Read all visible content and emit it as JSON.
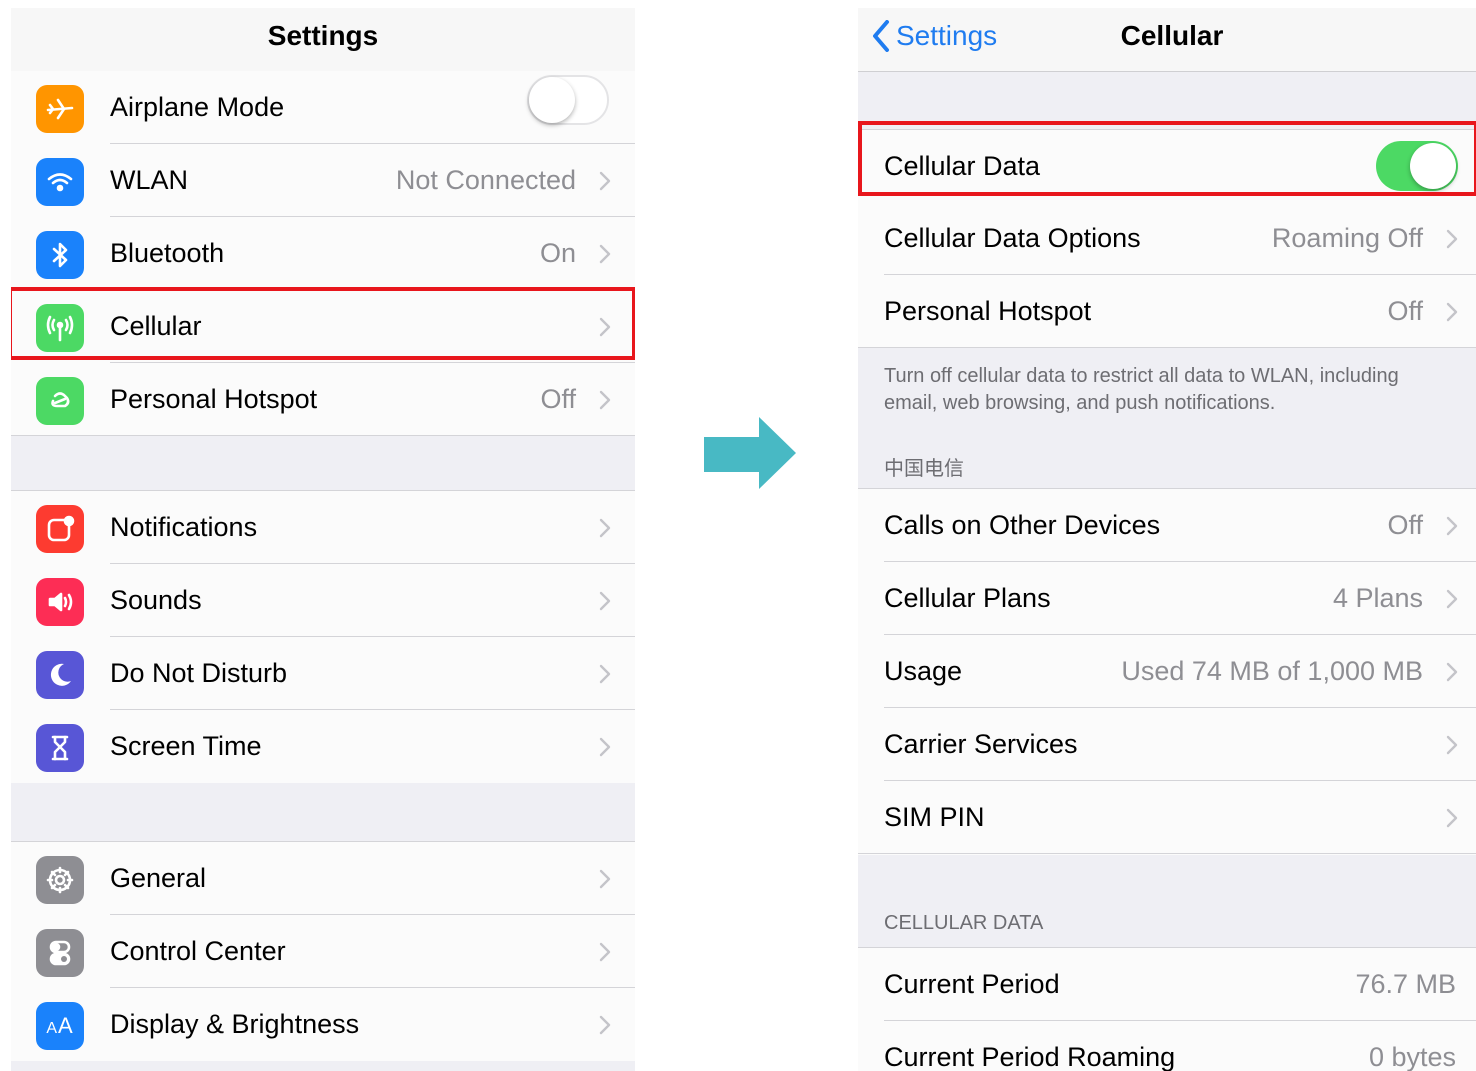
{
  "colors": {
    "highlight": "#e8161c",
    "arrow": "#48b9c4",
    "ios_blue": "#1f7cf0",
    "toggle_on": "#4cd964"
  },
  "left": {
    "title": "Settings",
    "groups": [
      [
        {
          "label": "Airplane Mode",
          "icon": "airplane-icon",
          "icon_color": "#ff9500",
          "control": "toggle",
          "toggle_on": false
        },
        {
          "label": "WLAN",
          "icon": "wifi-icon",
          "icon_color": "#1a82fb",
          "value": "Not Connected"
        },
        {
          "label": "Bluetooth",
          "icon": "bluetooth-icon",
          "icon_color": "#1a82fb",
          "value": "On"
        },
        {
          "label": "Cellular",
          "icon": "cellular-antenna-icon",
          "icon_color": "#4cd964",
          "value": "",
          "highlighted": true
        },
        {
          "label": "Personal Hotspot",
          "icon": "hotspot-icon",
          "icon_color": "#4cd964",
          "value": "Off"
        }
      ],
      [
        {
          "label": "Notifications",
          "icon": "notifications-icon",
          "icon_color": "#fd3b30",
          "value": ""
        },
        {
          "label": "Sounds",
          "icon": "speaker-icon",
          "icon_color": "#fd2d55",
          "value": ""
        },
        {
          "label": "Do Not Disturb",
          "icon": "moon-icon",
          "icon_color": "#5856d6",
          "value": ""
        },
        {
          "label": "Screen Time",
          "icon": "hourglass-icon",
          "icon_color": "#5856d6",
          "value": ""
        }
      ],
      [
        {
          "label": "General",
          "icon": "gear-icon",
          "icon_color": "#8e8e93",
          "value": ""
        },
        {
          "label": "Control Center",
          "icon": "switches-icon",
          "icon_color": "#8e8e93",
          "value": ""
        },
        {
          "label": "Display & Brightness",
          "icon": "text-size-icon",
          "icon_color": "#1a82fb",
          "value": "",
          "icon_text": "AA"
        }
      ]
    ]
  },
  "right": {
    "back_label": "Settings",
    "title": "Cellular",
    "cellular_data": {
      "label": "Cellular Data",
      "toggle_on": true,
      "highlighted": true
    },
    "group1": [
      {
        "label": "Cellular Data Options",
        "value": "Roaming Off"
      },
      {
        "label": "Personal Hotspot",
        "value": "Off"
      }
    ],
    "footer": "Turn off cellular data to restrict all data to WLAN, including email, web browsing, and push notifications.",
    "carrier_header": "中国电信",
    "group2": [
      {
        "label": "Calls on Other Devices",
        "value": "Off"
      },
      {
        "label": "Cellular Plans",
        "value": "4 Plans"
      },
      {
        "label": "Usage",
        "value": "Used 74 MB of 1,000 MB"
      },
      {
        "label": "Carrier Services",
        "value": ""
      },
      {
        "label": "SIM PIN",
        "value": ""
      }
    ],
    "data_header": "CELLULAR DATA",
    "group3": [
      {
        "label": "Current Period",
        "value": "76.7 MB"
      },
      {
        "label": "Current Period Roaming",
        "value": "0 bytes"
      }
    ]
  }
}
